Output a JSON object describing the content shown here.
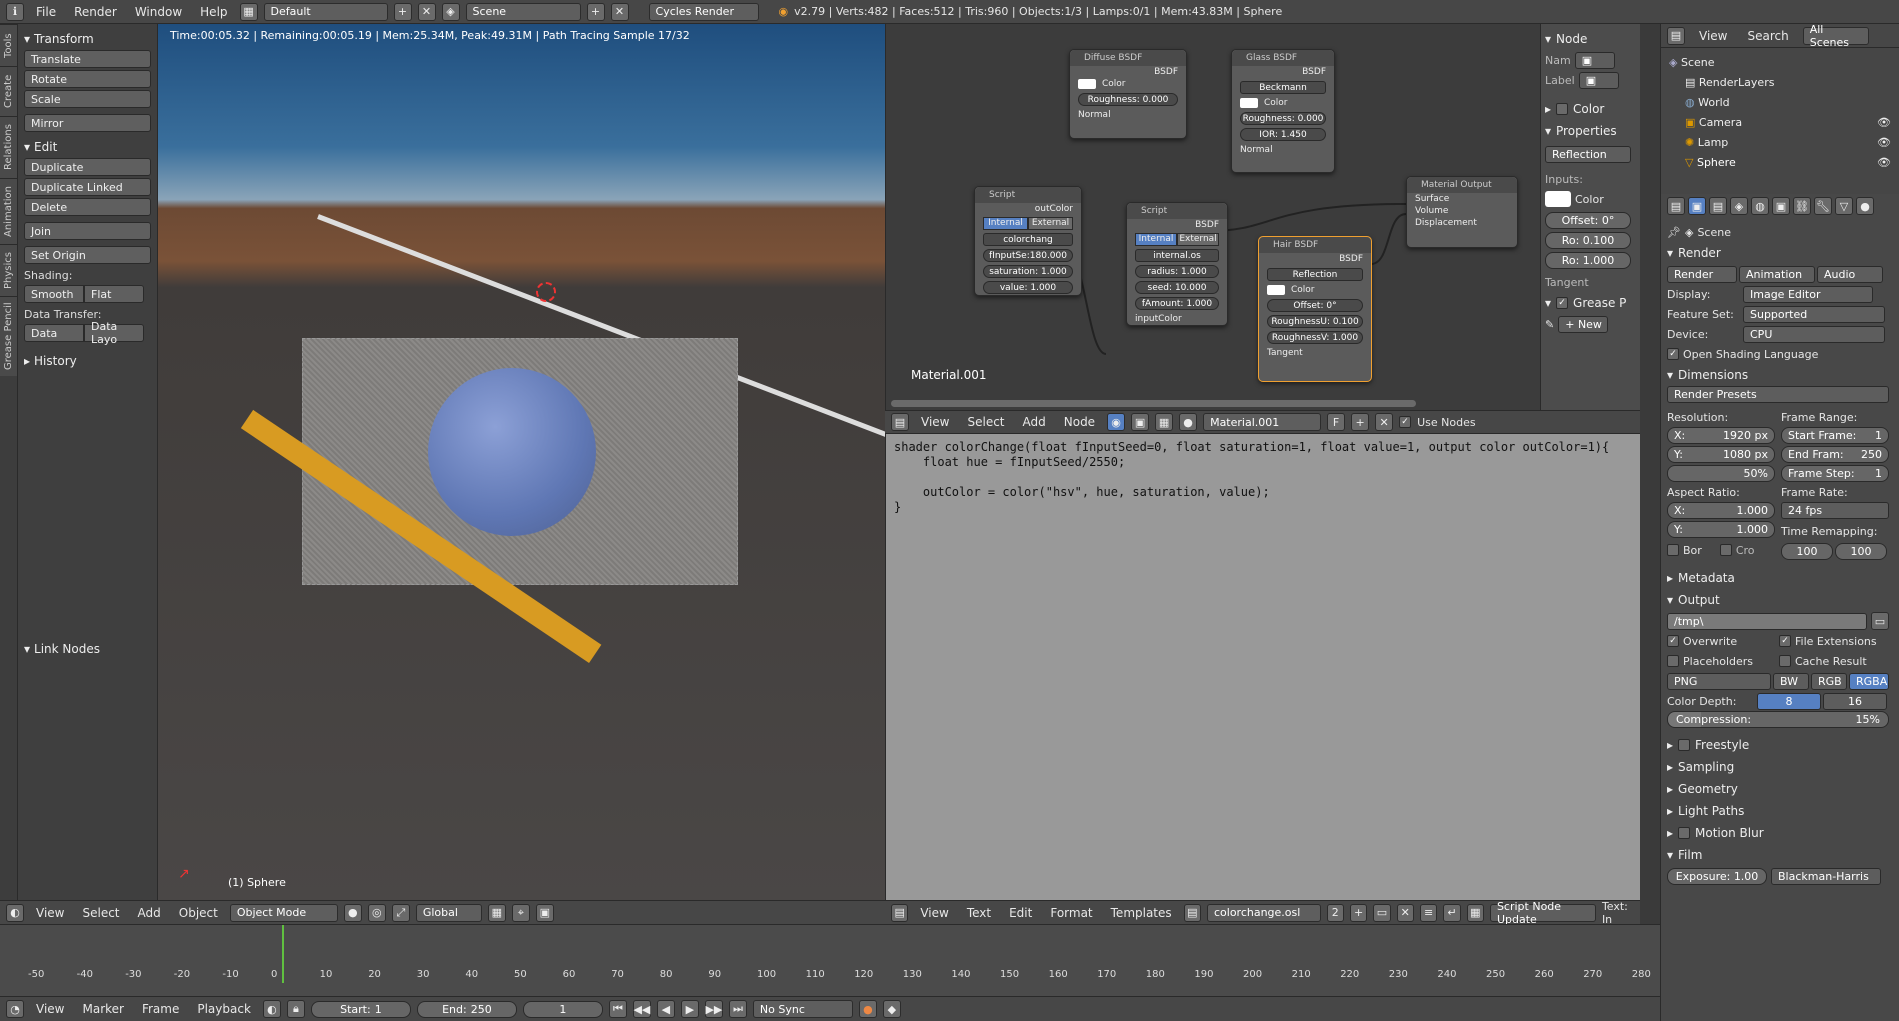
{
  "topbar": {
    "info_icon": "info-icon",
    "menus": [
      "File",
      "Render",
      "Window",
      "Help"
    ],
    "layout": "Default",
    "scene": "Scene",
    "engine": "Cycles Render",
    "stats": "v2.79 | Verts:482 | Faces:512 | Tris:960 | Objects:1/3 | Lamps:0/1 | Mem:43.83M | Sphere"
  },
  "toolstrip": {
    "tabs": [
      "Tools",
      "Create",
      "Relations",
      "Animation",
      "Physics",
      "Grease Pencil"
    ]
  },
  "toolshelf": {
    "transform": {
      "title": "Transform",
      "buttons": [
        "Translate",
        "Rotate",
        "Scale",
        "Mirror"
      ]
    },
    "edit": {
      "title": "Edit",
      "buttons": [
        "Duplicate",
        "Duplicate Linked",
        "Delete",
        "Join",
        "Set Origin"
      ]
    },
    "shading": {
      "label": "Shading:",
      "smooth": "Smooth",
      "flat": "Flat"
    },
    "data_transfer": {
      "label": "Data Transfer:",
      "data": "Data",
      "data_layo": "Data Layo"
    },
    "history": "History",
    "link_nodes": "Link Nodes"
  },
  "viewport": {
    "status": "Time:00:05.32 | Remaining:00:05.19 | Mem:25.34M, Peak:49.31M | Path Tracing Sample 17/32",
    "object_label": "(1) Sphere"
  },
  "nodes": {
    "diffuse": {
      "title": "Diffuse BSDF",
      "out": "BSDF",
      "color": "Color",
      "roughness": "Roughness:",
      "roughness_val": "0.000",
      "normal": "Normal"
    },
    "glass": {
      "title": "Glass BSDF",
      "out": "BSDF",
      "dist": "Beckmann",
      "color": "Color",
      "roughness": "Roughness:",
      "roughness_val": "0.000",
      "ior": "IOR:",
      "ior_val": "1.450",
      "normal": "Normal"
    },
    "script1": {
      "title": "Script",
      "out": "outColor",
      "internal": "Internal",
      "external": "External",
      "file": "colorchang",
      "f1": "fInputSe:",
      "f1v": "180.000",
      "f2": "saturation:",
      "f2v": "1.000",
      "f3": "value:",
      "f3v": "1.000"
    },
    "script2": {
      "title": "Script",
      "out": "BSDF",
      "internal": "Internal",
      "external": "External",
      "file": "internal.os",
      "f1": "radius:",
      "f1v": "1.000",
      "f2": "seed:",
      "f2v": "10.000",
      "f3": "fAmount:",
      "f3v": "1.000",
      "in": "inputColor"
    },
    "hair": {
      "title": "Hair BSDF",
      "out": "BSDF",
      "mode": "Reflection",
      "color": "Color",
      "offset": "Offset:",
      "offset_val": "0°",
      "ru": "RoughnessU:",
      "ru_val": "0.100",
      "rv": "RoughnessV:",
      "rv_val": "1.000",
      "tangent": "Tangent"
    },
    "output": {
      "title": "Material Output",
      "surface": "Surface",
      "volume": "Volume",
      "displacement": "Displacement"
    },
    "material_label": "Material.001"
  },
  "nodeside": {
    "node": "Node",
    "name": "Nam",
    "label": "Label",
    "color": "Color",
    "properties": "Properties",
    "reflection": "Reflection",
    "inputs": "Inputs:",
    "color2": "Color",
    "offset": "Offset: 0°",
    "ro1": "Ro: 0.100",
    "ro2": "Ro: 1.000",
    "tangent": "Tangent",
    "grease": "Grease P",
    "new": "New"
  },
  "nodeheader": {
    "menus": [
      "View",
      "Select",
      "Add",
      "Node"
    ],
    "material": "Material.001",
    "f": "F",
    "use_nodes": "Use Nodes"
  },
  "code": [
    "shader colorChange(float fInputSeed=0, float saturation=1, float value=1, output color outColor=1){",
    "    float hue = fInputSeed/2550;",
    "",
    "    outColor = color(\"hsv\", hue, saturation, value);",
    "}"
  ],
  "vpheader": {
    "menus": [
      "View",
      "Select",
      "Add",
      "Object"
    ],
    "mode": "Object Mode",
    "orientation": "Global"
  },
  "txheader": {
    "menus": [
      "View",
      "Text",
      "Edit",
      "Format",
      "Templates"
    ],
    "file": "colorchange.osl",
    "users": "2",
    "script_update": "Script Node Update",
    "text_in": "Text: In"
  },
  "timeline": {
    "ticks": [
      "-50",
      "-40",
      "-30",
      "-20",
      "-10",
      "0",
      "10",
      "20",
      "30",
      "40",
      "50",
      "60",
      "70",
      "80",
      "90",
      "100",
      "110",
      "120",
      "130",
      "140",
      "150",
      "160",
      "170",
      "180",
      "190",
      "200",
      "210",
      "220",
      "230",
      "240",
      "250",
      "260",
      "270",
      "280"
    ],
    "menus": [
      "View",
      "Marker",
      "Frame",
      "Playback"
    ],
    "start_label": "Start:",
    "start": "1",
    "end_label": "End:",
    "end": "250",
    "current": "1",
    "sync": "No Sync"
  },
  "outliner": {
    "menus": [
      "View",
      "Search"
    ],
    "filter": "All Scenes",
    "items": [
      "Scene",
      "RenderLayers",
      "World",
      "Camera",
      "Lamp",
      "Sphere"
    ]
  },
  "properties": {
    "scene": "Scene",
    "render": "Render",
    "tabs": [
      "Render",
      "Animation",
      "Audio"
    ],
    "display_label": "Display:",
    "display": "Image Editor",
    "feature_label": "Feature Set:",
    "feature": "Supported",
    "device_label": "Device:",
    "device": "CPU",
    "osl": "Open Shading Language",
    "dimensions": "Dimensions",
    "presets": "Render Presets",
    "resolution": "Resolution:",
    "res_x": "X:",
    "res_x_val": "1920 px",
    "res_y": "Y:",
    "res_y_val": "1080 px",
    "res_pct": "50%",
    "frame_range": "Frame Range:",
    "start_frame": "Start Frame:",
    "start_frame_val": "1",
    "end_frame": "End Fram:",
    "end_frame_val": "250",
    "frame_step": "Frame Step:",
    "frame_step_val": "1",
    "aspect": "Aspect Ratio:",
    "asp_x": "X:",
    "asp_x_val": "1.000",
    "asp_y": "Y:",
    "asp_y_val": "1.000",
    "frame_rate": "Frame Rate:",
    "fps": "24 fps",
    "time_remap": "Time Remapping:",
    "remap_old": "100",
    "remap_new": "100",
    "bor": "Bor",
    "cro": "Cro",
    "metadata": "Metadata",
    "output": "Output",
    "path": "/tmp\\",
    "overwrite": "Overwrite",
    "file_ext": "File Extensions",
    "placeholders": "Placeholders",
    "cache": "Cache Result",
    "format": "PNG",
    "bw": "BW",
    "rgb": "RGB",
    "rgba": "RGBA",
    "color_depth": "Color Depth:",
    "depth8": "8",
    "depth16": "16",
    "compression": "Compression:",
    "compression_val": "15%",
    "freestyle": "Freestyle",
    "sampling": "Sampling",
    "geometry": "Geometry",
    "light_paths": "Light Paths",
    "motion_blur": "Motion Blur",
    "film": "Film",
    "exposure": "Exposure: 1.00",
    "filter": "Blackman-Harris"
  }
}
